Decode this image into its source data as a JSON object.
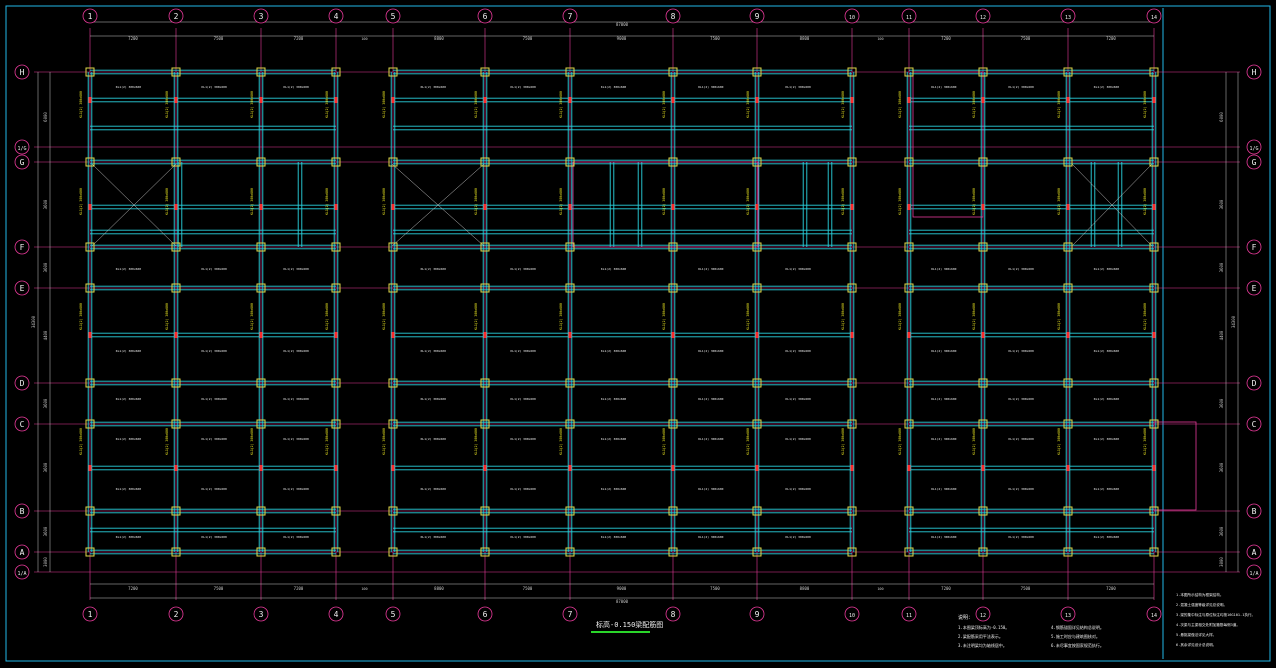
{
  "drawing": {
    "title": "标高-0.150梁配筋图",
    "colors": {
      "background": "#000000",
      "axis": "#e83a9a",
      "beam": "#2ad4e0",
      "column": "#e0d84a",
      "dimension": "#c8c8c8",
      "label_white": "#f0f0f0",
      "label_yellow": "#f2ee22",
      "red_mark": "#ff2a2a",
      "border": "#22b8e8",
      "title_underline": "#2ad62a"
    },
    "x_axes": [
      {
        "label": "1"
      },
      {
        "label": "2"
      },
      {
        "label": "3"
      },
      {
        "label": "4"
      },
      {
        "label": "5"
      },
      {
        "label": "6"
      },
      {
        "label": "7"
      },
      {
        "label": "8"
      },
      {
        "label": "9"
      },
      {
        "label": "10"
      },
      {
        "label": "11"
      },
      {
        "label": "12"
      },
      {
        "label": "13"
      },
      {
        "label": "14"
      }
    ],
    "y_axes": [
      {
        "label": "H"
      },
      {
        "label": "1/G"
      },
      {
        "label": "G"
      },
      {
        "label": "F"
      },
      {
        "label": "E"
      },
      {
        "label": "D"
      },
      {
        "label": "C"
      },
      {
        "label": "B"
      },
      {
        "label": "A"
      },
      {
        "label": "1/A"
      }
    ],
    "top_dimensions": [
      "7200",
      "7500",
      "7200",
      "8800",
      "7500",
      "9000",
      "7500",
      "8800",
      "7200",
      "7500",
      "7200"
    ],
    "top_total": "87000",
    "bottom_dimensions": [
      "7200",
      "7500",
      "7200",
      "8800",
      "7500",
      "9000",
      "7500",
      "8800",
      "7200",
      "7500",
      "7200"
    ],
    "bottom_total": "87000",
    "left_dimensions": [
      "6000",
      "3600",
      "3600",
      "4400",
      "3600",
      "3600",
      "3600",
      "3000"
    ],
    "left_total": "34300",
    "right_dimensions": [
      "6000",
      "3600",
      "3600",
      "4400",
      "3600",
      "3600",
      "3600",
      "3000"
    ],
    "right_total": "34300",
    "joint_label": "100",
    "beam_tag": "KL1(2) 300x600",
    "notes_title": "说明：",
    "notes": [
      "1.本图梁顶标高为-0.150。",
      "2.梁配筋采用平法表示。",
      "3.未注明梁均为轴线居中。",
      "4.钢筋锚固详见结构总说明。",
      "5.施工时应与建筑图核对。",
      "6.未尽事宜按国家规范执行。"
    ],
    "notes_right": [
      "1.本图所示结构为框架结构。",
      "2.混凝土强度等级详见总说明。",
      "3.梁的集中标注与原位标注均按16G101-1执行。",
      "4.次梁与主梁相交处附加箍筋每侧3道。",
      "5.悬挑梁做法详见大样。",
      "6.其余详见设计总说明。"
    ]
  }
}
